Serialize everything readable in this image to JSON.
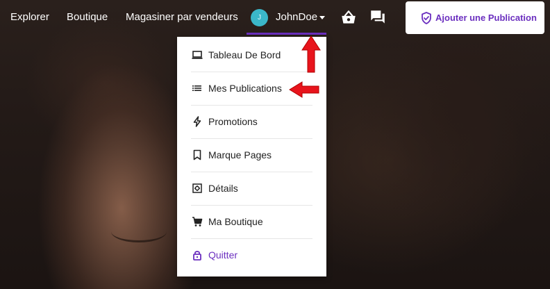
{
  "nav": {
    "explore": "Explorer",
    "shop": "Boutique",
    "shop_by_sellers": "Magasiner par vendeurs"
  },
  "user": {
    "initial": "J",
    "name": "JohnDoe"
  },
  "icons": {
    "cart": "basket-icon",
    "messages": "chat-icon"
  },
  "add_button": {
    "label": "Ajouter une Publication",
    "icon": "shield-check-icon"
  },
  "menu": {
    "items": [
      {
        "label": "Tableau De Bord",
        "icon": "laptop-icon"
      },
      {
        "label": "Mes Publications",
        "icon": "list-icon"
      },
      {
        "label": "Promotions",
        "icon": "bolt-icon"
      },
      {
        "label": "Marque Pages",
        "icon": "bookmark-icon"
      },
      {
        "label": "Détails",
        "icon": "settings-icon"
      },
      {
        "label": "Ma Boutique",
        "icon": "cart-icon"
      },
      {
        "label": "Quitter",
        "icon": "lock-icon"
      }
    ]
  },
  "colors": {
    "accent": "#6b2fbf",
    "avatar": "#3bb7c9",
    "annotation_arrow": "#e8141c"
  }
}
